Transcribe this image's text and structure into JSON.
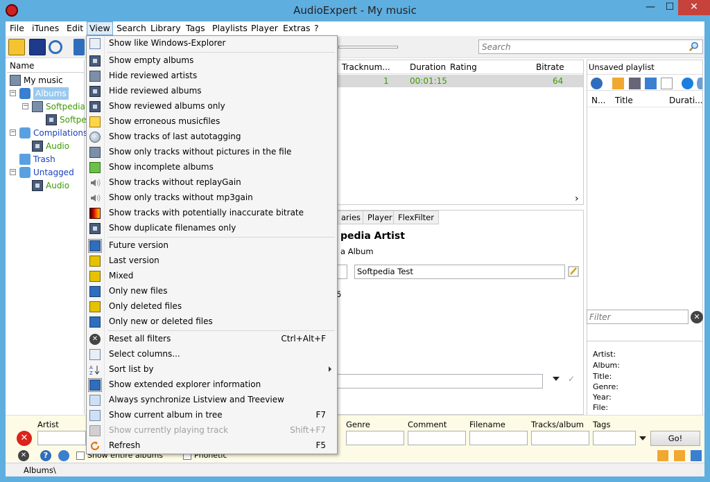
{
  "window": {
    "title": "AudioExpert - My music",
    "minimize": "—",
    "maximize": "☐",
    "close": "✕"
  },
  "menubar": [
    "File",
    "iTunes",
    "Edit",
    "View",
    "Search",
    "Library",
    "Tags",
    "Playlists",
    "Player",
    "Extras",
    "?"
  ],
  "search": {
    "placeholder": "Search"
  },
  "tree": {
    "header": "Name",
    "nodes": [
      "My music",
      "Albums",
      "Softpedia",
      "Softpe",
      "Compilations",
      "Audio",
      "Trash",
      "Untagged",
      "Audio"
    ]
  },
  "list": {
    "columns": [
      "Tracknum...",
      "Duration",
      "Rating",
      "Bitrate"
    ],
    "row": {
      "tracknum": "1",
      "duration": "00:01:15",
      "bitrate": "64"
    },
    "scroll_arrow": "›"
  },
  "playlist": {
    "title": "Unsaved playlist",
    "columns": [
      "N...",
      "Title",
      "Durati..."
    ],
    "filter_placeholder": "Filter",
    "clear": "✕"
  },
  "info": {
    "labels": [
      "Artist:",
      "Album:",
      "Title:",
      "Genre:",
      "Year:",
      "File:"
    ]
  },
  "detail": {
    "tabs": [
      "aries",
      "Player",
      "FlexFilter"
    ],
    "artist": "pedia Artist",
    "album": "a Album",
    "title_value": "Softpedia Test",
    "fragment": "5",
    "confirm": "✓"
  },
  "bottom": {
    "labels": [
      "Artist",
      "Genre",
      "Comment",
      "Filename",
      "Tracks/album",
      "Tags"
    ],
    "go_label": "Go!",
    "clear": "✕",
    "help": "?",
    "checkbox1": "Show entire albums",
    "checkbox2": "Phonetic"
  },
  "status": {
    "path": "Albums\\"
  },
  "view_menu": {
    "items": [
      {
        "label": "Show like Windows-Explorer",
        "key": ""
      },
      {
        "label": "Show empty albums",
        "key": ""
      },
      {
        "label": "Hide reviewed artists",
        "key": ""
      },
      {
        "label": "Hide reviewed albums",
        "key": ""
      },
      {
        "label": "Show reviewed albums only",
        "key": ""
      },
      {
        "label": "Show erroneous musicfiles",
        "key": ""
      },
      {
        "label": "Show tracks of last autotagging",
        "key": ""
      },
      {
        "label": "Show only tracks without pictures in the file",
        "key": ""
      },
      {
        "label": "Show incomplete albums",
        "key": ""
      },
      {
        "label": "Show tracks without replayGain",
        "key": ""
      },
      {
        "label": "Show only tracks without mp3gain",
        "key": ""
      },
      {
        "label": "Show tracks with potentially inaccurate bitrate",
        "key": ""
      },
      {
        "label": "Show duplicate filenames only",
        "key": ""
      },
      {
        "label": "Future version",
        "key": ""
      },
      {
        "label": "Last version",
        "key": ""
      },
      {
        "label": "Mixed",
        "key": ""
      },
      {
        "label": "Only new files",
        "key": ""
      },
      {
        "label": "Only deleted files",
        "key": ""
      },
      {
        "label": "Only new or deleted files",
        "key": ""
      },
      {
        "label": "Reset all filters",
        "key": "Ctrl+Alt+F"
      },
      {
        "label": "Select columns...",
        "key": ""
      },
      {
        "label": "Sort list by",
        "key": ""
      },
      {
        "label": "Show extended explorer information",
        "key": ""
      },
      {
        "label": "Always synchronize Listview and Treeview",
        "key": ""
      },
      {
        "label": "Show current album in tree",
        "key": "F7"
      },
      {
        "label": "Show currently playing track",
        "key": "Shift+F7"
      },
      {
        "label": "Refresh",
        "key": "F5"
      }
    ]
  },
  "colors": {
    "title_bar": "#5faee0",
    "accent_green": "#3c9a00",
    "link_blue": "#1a3fbf",
    "selection": "#99c9ef",
    "filter_panel": "#fdfbe5"
  }
}
